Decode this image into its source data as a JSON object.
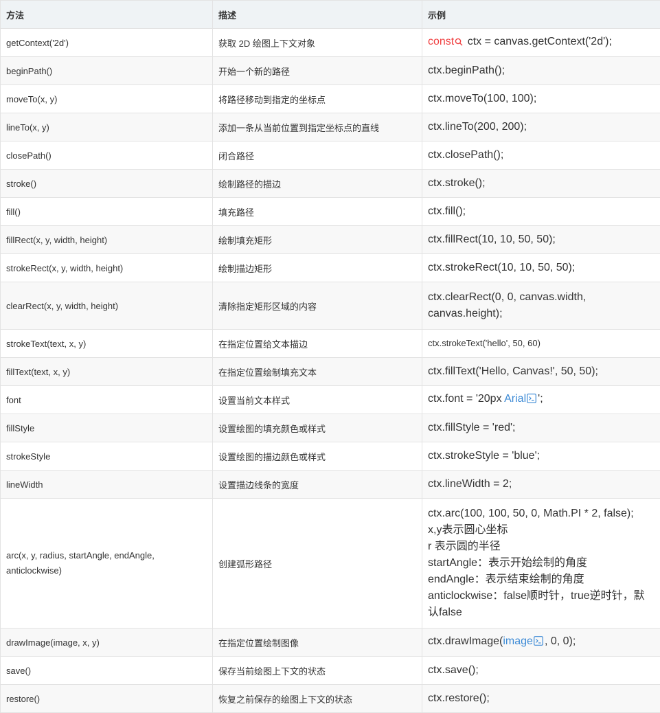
{
  "table": {
    "headers": [
      "方法",
      "描述",
      "示例"
    ],
    "rows": [
      {
        "method": "getContext('2d')",
        "desc": "获取 2D 绘图上下文对象",
        "example": [
          "ctx = canvas.getContext('2d');"
        ],
        "kw": "const"
      },
      {
        "method": "beginPath()",
        "desc": "开始一个新的路径",
        "example": [
          "ctx.beginPath();"
        ]
      },
      {
        "method": "moveTo(x, y)",
        "desc": "将路径移动到指定的坐标点",
        "example": [
          "ctx.moveTo(100, 100);"
        ]
      },
      {
        "method": "lineTo(x, y)",
        "desc": "添加一条从当前位置到指定坐标点的直线",
        "example": [
          "ctx.lineTo(200, 200);"
        ]
      },
      {
        "method": "closePath()",
        "desc": "闭合路径",
        "example": [
          "ctx.closePath();"
        ]
      },
      {
        "method": "stroke()",
        "desc": "绘制路径的描边",
        "example": [
          "ctx.stroke();"
        ]
      },
      {
        "method": "fill()",
        "desc": "填充路径",
        "example": [
          "ctx.fill();"
        ]
      },
      {
        "method": "fillRect(x, y, width, height)",
        "desc": "绘制填充矩形",
        "example": [
          "ctx.fillRect(10, 10, 50, 50);"
        ]
      },
      {
        "method": "strokeRect(x, y, width, height)",
        "desc": "绘制描边矩形",
        "example": [
          "ctx.strokeRect(10, 10, 50, 50);"
        ]
      },
      {
        "method": "clearRect(x, y, width, height)",
        "desc": "清除指定矩形区域的内容",
        "example": [
          "ctx.clearRect(0, 0, canvas.width,",
          "canvas.height);"
        ]
      },
      {
        "method": "strokeText(text, x,  y)",
        "desc": "在指定位置给文本描边",
        "example": [
          "ctx.strokeText('hello', 50, 60)"
        ]
      },
      {
        "method": "fillText(text, x, y)",
        "desc": "在指定位置绘制填充文本",
        "example": [
          "ctx.fillText('Hello, Canvas!', 50, 50);"
        ]
      },
      {
        "method": "font",
        "desc": "设置当前文本样式",
        "example_pre": "ctx.font = '20px ",
        "example_link": "Arial",
        "example_post": "';"
      },
      {
        "method": "fillStyle",
        "desc": "设置绘图的填充颜色或样式",
        "example": [
          "ctx.fillStyle = 'red';"
        ]
      },
      {
        "method": "strokeStyle",
        "desc": "设置绘图的描边颜色或样式",
        "example": [
          "ctx.strokeStyle = 'blue';"
        ]
      },
      {
        "method": "lineWidth",
        "desc": "设置描边线条的宽度",
        "example": [
          "ctx.lineWidth = 2;"
        ]
      },
      {
        "method": "arc(x, y, radius, startAngle, endAngle, anticlockwise)",
        "desc": "创建弧形路径",
        "example": [
          "ctx.arc(100, 100, 50, 0, Math.PI * 2, false);",
          "x,y表示圆心坐标",
          "r 表示圆的半径",
          "startAngle：表示开始绘制的角度",
          "endAngle：表示结束绘制的角度",
          "anticlockwise：false顺时针，true逆时针，默认false"
        ]
      },
      {
        "method": "drawImage(image, x, y)",
        "desc": "在指定位置绘制图像",
        "example_pre": "ctx.drawImage(",
        "example_link": "image",
        "example_post": ", 0, 0);"
      },
      {
        "method": "save()",
        "desc": "保存当前绘图上下文的状态",
        "example": [
          "ctx.save();"
        ]
      },
      {
        "method": "restore()",
        "desc": "恢复之前保存的绘图上下文的状态",
        "example": [
          "ctx.restore();"
        ]
      }
    ]
  },
  "colors": {
    "keyword": "#f04142",
    "link": "#3e8bd6",
    "header_bg": "#eff3f5",
    "stripe_bg": "#f8f8f8",
    "border": "#e3e3e3"
  },
  "icons": {
    "search": "search-icon",
    "code_run": "code-run-icon"
  }
}
